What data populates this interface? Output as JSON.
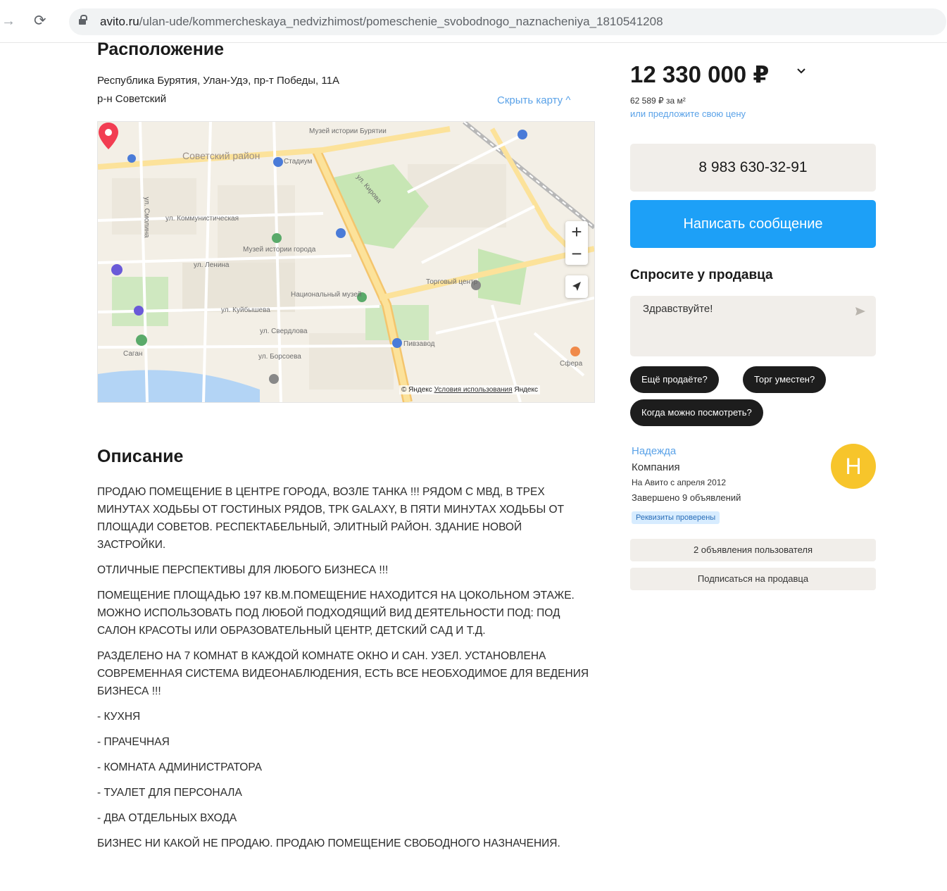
{
  "browser": {
    "url_domain": "avito.ru",
    "url_path": "/ulan-ude/kommercheskaya_nedvizhimost/pomeschenie_svobodnogo_naznacheniya_1810541208"
  },
  "location": {
    "title": "Расположение",
    "address": "Республика Бурятия, Улан-Удэ, пр-т Победы, 11А",
    "district": "р-н Советский",
    "hide_map": "Скрыть карту ^",
    "map_labels": [
      "Советский район",
      "Музей истории Бурятии",
      "Стадиум",
      "ул. Коммунистическая",
      "ул. Ленина",
      "ул. Кирова",
      "ул. Куйбышева",
      "ул. Смолина",
      "ул. Свердлова",
      "ул. Борсоева",
      "Торговый центр",
      "Музей истории города",
      "Национальный музей",
      "Саган",
      "Пивзавод",
      "Сфера"
    ],
    "map_zoom_in": "+",
    "map_zoom_out": "−",
    "map_footer_prefix": "© Яндекс",
    "map_footer_terms": "Условия использования",
    "map_footer_brand": "Яндекс"
  },
  "description": {
    "title": "Описание",
    "paragraphs": [
      "ПРОДАЮ ПОМЕЩЕНИЕ В ЦЕНТРЕ ГОРОДА, ВОЗЛЕ ТАНКА !!! РЯДОМ С МВД, В ТРЕХ МИНУТАХ ХОДЬБЫ ОТ ГОСТИНЫХ РЯДОВ, ТРК GALAXY, В ПЯТИ МИНУТАХ ХОДЬБЫ ОТ ПЛОЩАДИ СОВЕТОВ. РЕСПЕКТАБЕЛЬНЫЙ, ЭЛИТНЫЙ РАЙОН. ЗДАНИЕ НОВОЙ ЗАСТРОЙКИ.",
      "ОТЛИЧНЫЕ ПЕРСПЕКТИВЫ ДЛЯ ЛЮБОГО БИЗНЕСА !!!",
      "ПОМЕЩЕНИЕ ПЛОЩАДЬЮ 197 КВ.М.ПОМЕЩЕНИЕ НАХОДИТСЯ НА ЦОКОЛЬНОМ ЭТАЖЕ. МОЖНО ИСПОЛЬЗОВАТЬ ПОД ЛЮБОЙ ПОДХОДЯЩИЙ ВИД ДЕЯТЕЛЬНОСТИ ПОД: ПОД САЛОН КРАСОТЫ ИЛИ ОБРАЗОВАТЕЛЬНЫЙ ЦЕНТР, ДЕТСКИЙ САД И Т.Д.",
      "РАЗДЕЛЕНО НА 7 КОМНАТ В КАЖДОЙ КОМНАТЕ ОКНО И САН. УЗЕЛ. УСТАНОВЛЕНА СОВРЕМЕННАЯ СИСТЕМА ВИДЕОНАБЛЮДЕНИЯ, ЕСТЬ ВСЕ НЕОБХОДИМОЕ ДЛЯ ВЕДЕНИЯ БИЗНЕСА !!!",
      "- КУХНЯ",
      "- ПРАЧЕЧНАЯ",
      "- КОМНАТА АДМИНИСТРАТОРА",
      "- ТУАЛЕТ ДЛЯ ПЕРСОНАЛА",
      "- ДВА ОТДЕЛЬНЫХ ВХОДА",
      "БИЗНЕС НИ КАКОЙ НЕ ПРОДАЮ. ПРОДАЮ ПОМЕЩЕНИЕ СВОБОДНОГО НАЗНАЧЕНИЯ."
    ]
  },
  "sidebar": {
    "price": "12 330 000 ₽",
    "price_per_m2": "62 589 ₽ за м²",
    "offer_link": "или предложите свою цену",
    "phone": "8 983 630-32-91",
    "write_message": "Написать сообщение",
    "ask_title": "Спросите у продавца",
    "ask_placeholder": "Здравствуйте!",
    "chips": [
      "Ещё продаёте?",
      "Торг уместен?",
      "Когда можно посмотреть?"
    ],
    "seller": {
      "name": "Надежда",
      "type": "Компания",
      "since": "На Авито с апреля 2012",
      "completed": "Завершено 9 объявлений",
      "badge": "Реквизиты проверены",
      "avatar_letter": "Н"
    },
    "user_ads": "2 объявления пользователя",
    "subscribe": "Подписаться на продавца"
  },
  "colors": {
    "accent_blue": "#1da0f7",
    "link_blue": "#5aa2e8",
    "pin_red": "#f23d52",
    "avatar_yellow": "#f7c52b"
  }
}
